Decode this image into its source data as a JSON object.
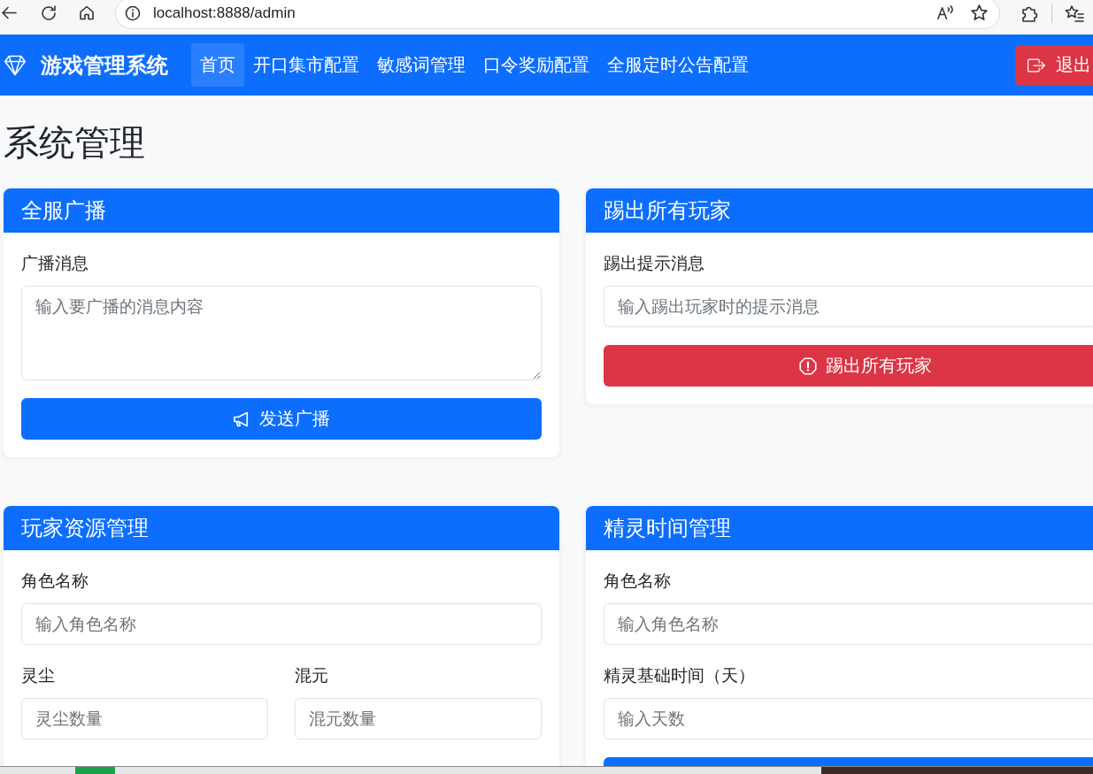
{
  "browser": {
    "url": "localhost:8888/admin"
  },
  "navbar": {
    "brand": "游戏管理系统",
    "links": [
      {
        "label": "首页",
        "selected": true
      },
      {
        "label": "开口集市配置",
        "selected": false
      },
      {
        "label": "敏感词管理",
        "selected": false
      },
      {
        "label": "口令奖励配置",
        "selected": false
      },
      {
        "label": "全服定时公告配置",
        "selected": false
      }
    ],
    "logout": "退出"
  },
  "page_title": "系统管理",
  "cards": [
    {
      "title": "全服广播",
      "fields": [
        {
          "kind": "textarea",
          "label": "广播消息",
          "placeholder": "输入要广播的消息内容"
        }
      ],
      "button": {
        "kind": "broadcast",
        "label": "发送广播"
      }
    },
    {
      "title": "踢出所有玩家",
      "fields": [
        {
          "kind": "input",
          "label": "踢出提示消息",
          "placeholder": "输入踢出玩家时的提示消息"
        }
      ],
      "button": {
        "kind": "kick",
        "label": "踢出所有玩家"
      }
    },
    {
      "title": "玩家资源管理",
      "fields": [
        {
          "kind": "input",
          "label": "角色名称",
          "placeholder": "输入角色名称"
        },
        {
          "kind": "pair",
          "items": [
            {
              "label": "灵尘",
              "placeholder": "灵尘数量"
            },
            {
              "label": "混元",
              "placeholder": "混元数量"
            }
          ]
        }
      ]
    },
    {
      "title": "精灵时间管理",
      "fields": [
        {
          "kind": "input",
          "label": "角色名称",
          "placeholder": "输入角色名称"
        },
        {
          "kind": "input",
          "label": "精灵基础时间（天）",
          "placeholder": "输入天数"
        }
      ],
      "button": {
        "kind": "plain"
      }
    }
  ]
}
